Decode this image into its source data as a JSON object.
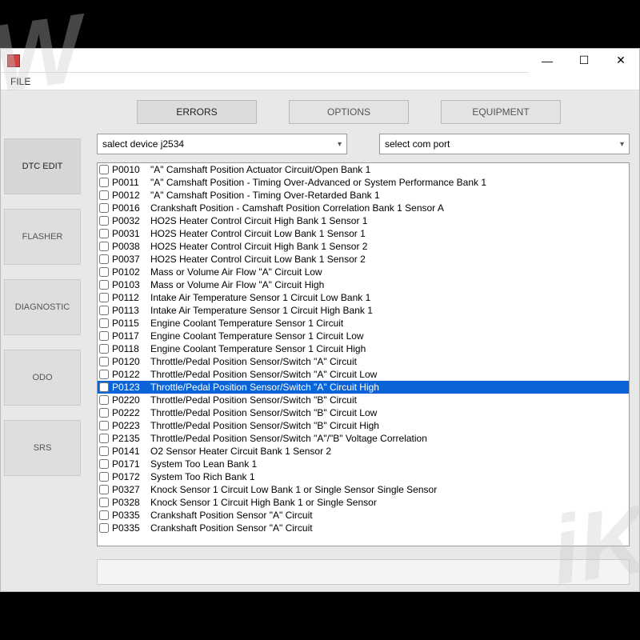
{
  "window": {
    "menu_file": "FILE",
    "min_glyph": "—",
    "max_glyph": "☐",
    "close_glyph": "✕"
  },
  "toptabs": {
    "errors": "ERRORS",
    "options": "OPTIONS",
    "equipment": "EQUIPMENT"
  },
  "sidebar": {
    "dtc": "DTC EDIT",
    "flasher": "FLASHER",
    "diagnostic": "DIAGNOSTIC",
    "odo": "ODO",
    "srs": "SRS"
  },
  "selects": {
    "device": "salect device j2534",
    "comport": "select com port"
  },
  "dtc_list": [
    {
      "code": "P0010",
      "desc": "\"A\" Camshaft Position Actuator Circuit/Open Bank 1",
      "sel": false
    },
    {
      "code": "P0011",
      "desc": "\"A\" Camshaft Position - Timing Over-Advanced or System Performance Bank 1",
      "sel": false
    },
    {
      "code": "P0012",
      "desc": "\"A\" Camshaft Position - Timing Over-Retarded Bank 1",
      "sel": false
    },
    {
      "code": "P0016",
      "desc": "Crankshaft Position - Camshaft Position Correlation Bank 1 Sensor A",
      "sel": false
    },
    {
      "code": "P0032",
      "desc": "HO2S Heater Control Circuit High Bank 1 Sensor 1",
      "sel": false
    },
    {
      "code": "P0031",
      "desc": "HO2S Heater Control Circuit Low Bank 1 Sensor 1",
      "sel": false
    },
    {
      "code": "P0038",
      "desc": "HO2S Heater Control Circuit High Bank 1 Sensor 2",
      "sel": false
    },
    {
      "code": "P0037",
      "desc": "HO2S Heater Control Circuit Low Bank 1 Sensor 2",
      "sel": false
    },
    {
      "code": "P0102",
      "desc": "Mass or Volume Air Flow \"A\" Circuit Low",
      "sel": false
    },
    {
      "code": "P0103",
      "desc": "Mass or Volume Air Flow \"A\" Circuit High",
      "sel": false
    },
    {
      "code": "P0112",
      "desc": "Intake Air Temperature Sensor 1 Circuit Low Bank 1",
      "sel": false
    },
    {
      "code": "P0113",
      "desc": "Intake Air Temperature Sensor 1 Circuit High Bank 1",
      "sel": false
    },
    {
      "code": "P0115",
      "desc": "Engine Coolant Temperature Sensor 1 Circuit",
      "sel": false
    },
    {
      "code": "P0117",
      "desc": "Engine Coolant Temperature Sensor 1 Circuit Low",
      "sel": false
    },
    {
      "code": "P0118",
      "desc": "Engine Coolant Temperature Sensor 1 Circuit High",
      "sel": false
    },
    {
      "code": "P0120",
      "desc": "Throttle/Pedal Position Sensor/Switch \"A\" Circuit",
      "sel": false
    },
    {
      "code": "P0122",
      "desc": "Throttle/Pedal Position Sensor/Switch \"A\" Circuit Low",
      "sel": false
    },
    {
      "code": "P0123",
      "desc": "Throttle/Pedal Position Sensor/Switch \"A\" Circuit High",
      "sel": true
    },
    {
      "code": "P0220",
      "desc": "Throttle/Pedal Position Sensor/Switch \"B\" Circuit",
      "sel": false
    },
    {
      "code": "P0222",
      "desc": "Throttle/Pedal Position Sensor/Switch \"B\" Circuit Low",
      "sel": false
    },
    {
      "code": "P0223",
      "desc": "Throttle/Pedal Position Sensor/Switch \"B\" Circuit High",
      "sel": false
    },
    {
      "code": "P2135",
      "desc": "Throttle/Pedal Position Sensor/Switch \"A\"/\"B\" Voltage Correlation",
      "sel": false
    },
    {
      "code": "P0141",
      "desc": "O2 Sensor Heater Circuit Bank 1 Sensor 2",
      "sel": false
    },
    {
      "code": "P0171",
      "desc": "System Too Lean Bank 1",
      "sel": false
    },
    {
      "code": "P0172",
      "desc": "System Too Rich Bank 1",
      "sel": false
    },
    {
      "code": "P0327",
      "desc": "Knock Sensor 1 Circuit Low Bank 1 or Single Sensor Single Sensor",
      "sel": false
    },
    {
      "code": "P0328",
      "desc": "Knock Sensor 1 Circuit High Bank 1 or Single Sensor",
      "sel": false
    },
    {
      "code": "P0335",
      "desc": "Crankshaft Position Sensor \"A\" Circuit",
      "sel": false
    },
    {
      "code": "P0335",
      "desc": "Crankshaft Position Sensor \"A\" Circuit",
      "sel": false
    }
  ]
}
